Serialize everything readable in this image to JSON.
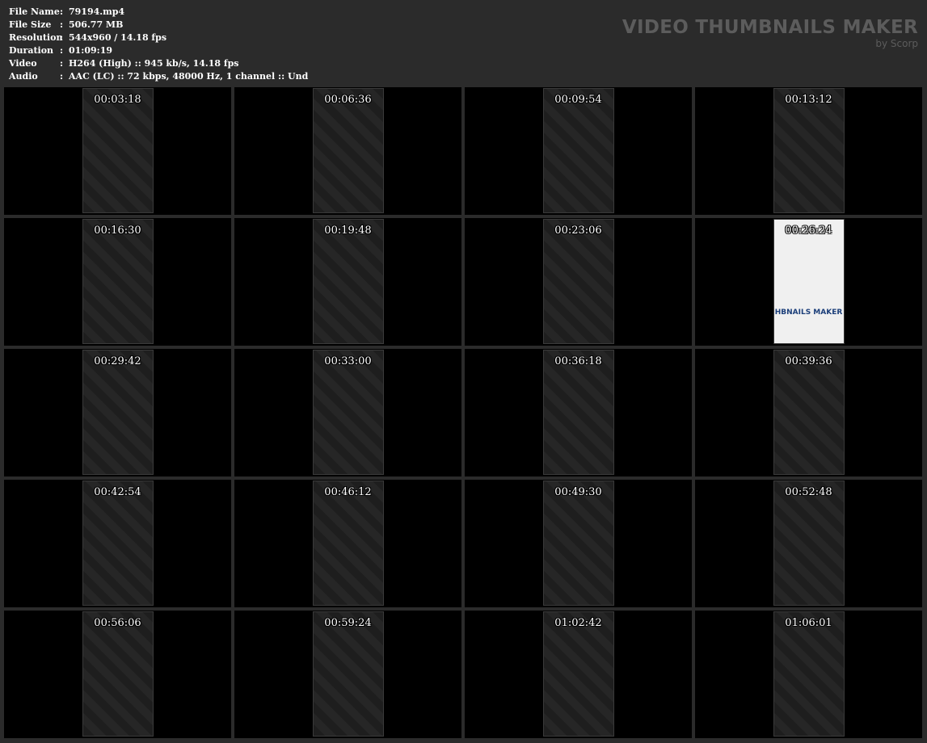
{
  "meta": [
    {
      "key": "File Name",
      "sep": ":",
      "value": "79194.mp4"
    },
    {
      "key": "File Size",
      "sep": ":",
      "value": "506.77 MB"
    },
    {
      "key": "Resolution",
      "sep": ":",
      "value": "544x960 / 14.18 fps"
    },
    {
      "key": "Duration",
      "sep": ":",
      "value": "01:09:19"
    },
    {
      "key": "Video",
      "sep": ":",
      "value": "H264 (High) :: 945 kb/s, 14.18 fps"
    },
    {
      "key": "Audio",
      "sep": ":",
      "value": "AAC (LC) :: 72 kbps, 48000 Hz, 1 channel :: Und"
    }
  ],
  "brand": {
    "title": "VIDEO THUMBNAILS MAKER",
    "sub": "by Scorp"
  },
  "thumbnails": [
    {
      "time": "00:03:18"
    },
    {
      "time": "00:06:36"
    },
    {
      "time": "00:09:54"
    },
    {
      "time": "00:13:12"
    },
    {
      "time": "00:16:30"
    },
    {
      "time": "00:19:48"
    },
    {
      "time": "00:23:06"
    },
    {
      "time": "00:26:24",
      "logo_text": "HBNAILS MAKER"
    },
    {
      "time": "00:29:42"
    },
    {
      "time": "00:33:00"
    },
    {
      "time": "00:36:18"
    },
    {
      "time": "00:39:36"
    },
    {
      "time": "00:42:54"
    },
    {
      "time": "00:46:12"
    },
    {
      "time": "00:49:30"
    },
    {
      "time": "00:52:48"
    },
    {
      "time": "00:56:06"
    },
    {
      "time": "00:59:24"
    },
    {
      "time": "01:02:42"
    },
    {
      "time": "01:06:01"
    }
  ]
}
